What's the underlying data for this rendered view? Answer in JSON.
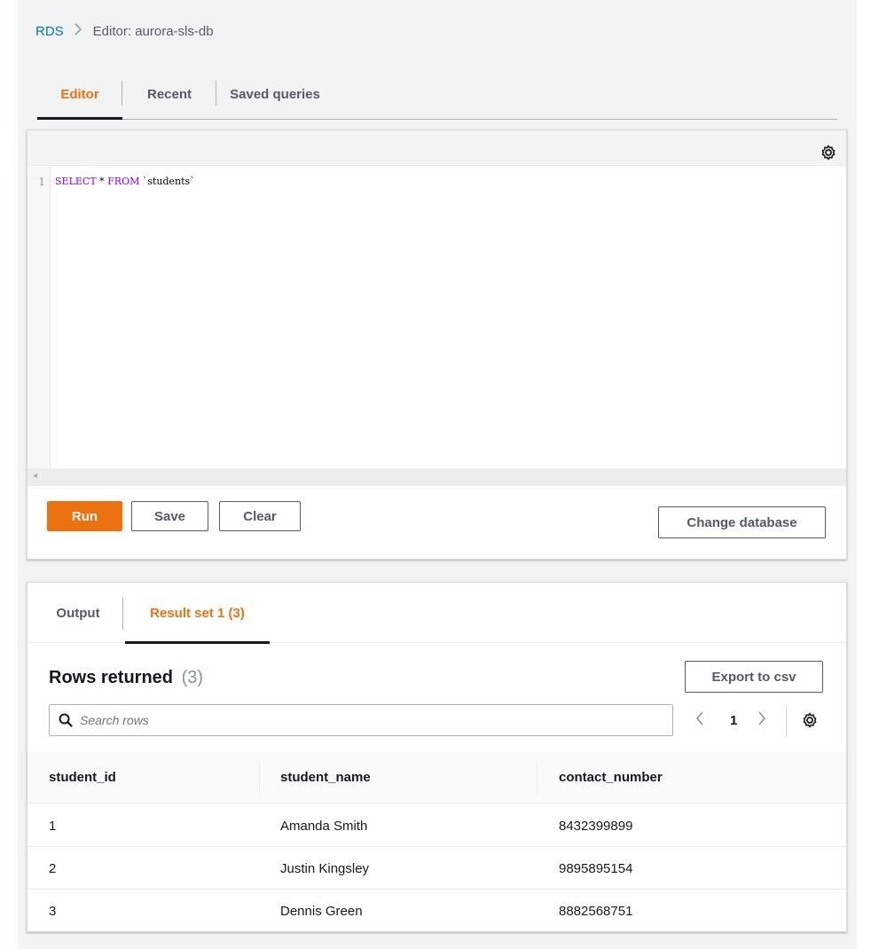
{
  "breadcrumb": {
    "root": "RDS",
    "current": "Editor: aurora-sls-db"
  },
  "top_tabs": [
    {
      "label": "Editor"
    },
    {
      "label": "Recent"
    },
    {
      "label": "Saved queries"
    }
  ],
  "editor": {
    "line_number": "1",
    "code_keyword1": "SELECT",
    "code_middle": " * ",
    "code_keyword2": "FROM",
    "code_rest": " `students`"
  },
  "actions": {
    "run": "Run",
    "save": "Save",
    "clear": "Clear",
    "change_database": "Change database"
  },
  "result_tabs": [
    {
      "label": "Output"
    },
    {
      "label": "Result set 1 (3)"
    }
  ],
  "results": {
    "title": "Rows returned",
    "count": "(3)",
    "export": "Export to csv",
    "search_placeholder": "Search rows",
    "page": "1",
    "columns": [
      "student_id",
      "student_name",
      "contact_number"
    ],
    "rows": [
      [
        "1",
        "Amanda Smith",
        "8432399899"
      ],
      [
        "2",
        "Justin Kingsley",
        "9895895154"
      ],
      [
        "3",
        "Dennis Green",
        "8882568751"
      ]
    ]
  },
  "colors": {
    "accent": "#ec7211",
    "link": "#0073bb"
  }
}
